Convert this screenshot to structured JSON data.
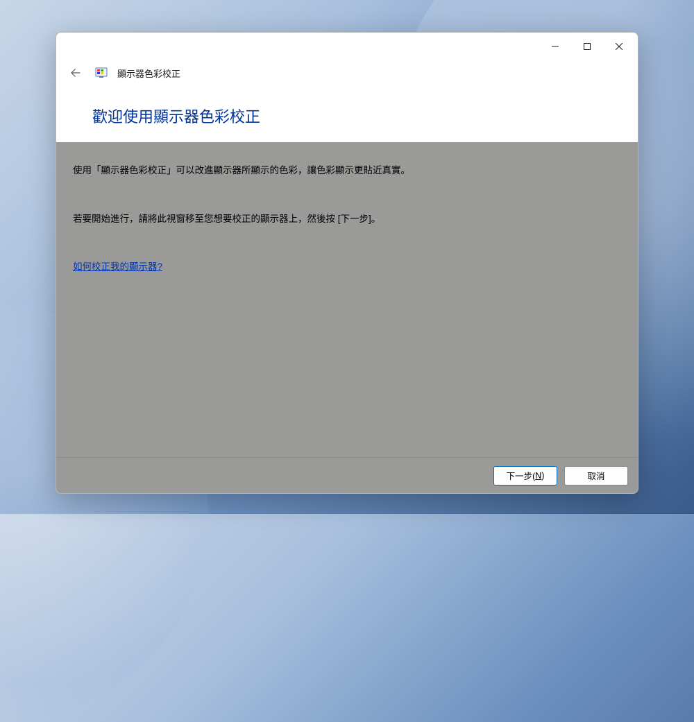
{
  "window": {
    "app_title": "顯示器色彩校正",
    "heading": "歡迎使用顯示器色彩校正"
  },
  "content": {
    "paragraph1": "使用「顯示器色彩校正」可以改進顯示器所顯示的色彩，讓色彩顯示更貼近真實。",
    "paragraph2": "若要開始進行，請將此視窗移至您想要校正的顯示器上，然後按 [下一步]。",
    "help_link": "如何校正我的顯示器?"
  },
  "footer": {
    "next_prefix": "下一步(",
    "next_key": "N",
    "next_suffix": ")",
    "cancel": "取消"
  }
}
